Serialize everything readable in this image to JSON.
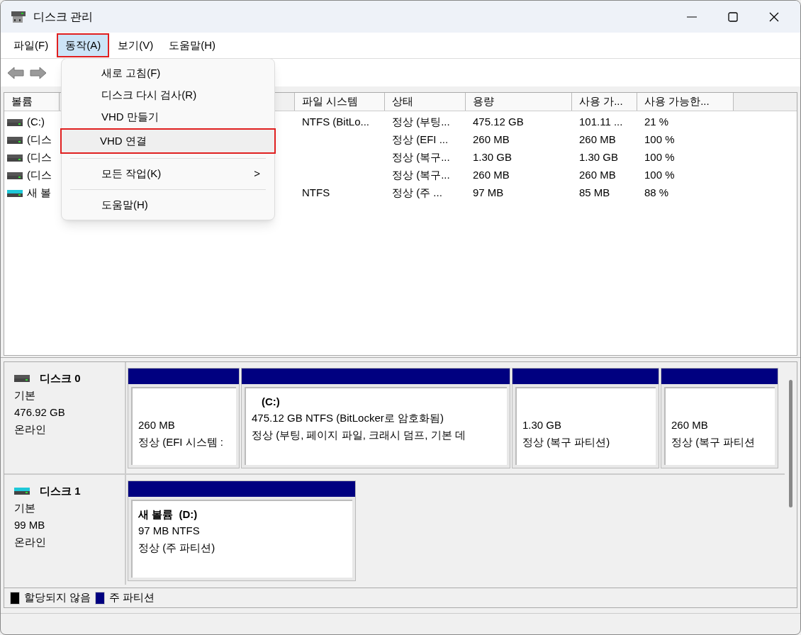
{
  "window": {
    "title": "디스크 관리"
  },
  "menu_bar": [
    {
      "label": "파일(F)",
      "selected": false
    },
    {
      "label": "동작(A)",
      "selected": true
    },
    {
      "label": "보기(V)",
      "selected": false
    },
    {
      "label": "도움말(H)",
      "selected": false
    }
  ],
  "dropdown_menu": [
    {
      "kind": "item",
      "label": "새로 고침(F)",
      "highlighted": false
    },
    {
      "kind": "item",
      "label": "디스크 다시 검사(R)",
      "highlighted": false
    },
    {
      "kind": "item",
      "label": "VHD 만들기",
      "highlighted": false
    },
    {
      "kind": "item",
      "label": "VHD 연결",
      "highlighted": true
    },
    {
      "kind": "separator"
    },
    {
      "kind": "submenu",
      "label": "모든 작업(K)",
      "arrow": ">",
      "highlighted": false
    },
    {
      "kind": "separator"
    },
    {
      "kind": "item",
      "label": "도움말(H)",
      "highlighted": false
    }
  ],
  "volume_table": {
    "columns": [
      "볼륨",
      "파일 시스템",
      "상태",
      "용량",
      "사용 가...",
      "사용 가능한..."
    ],
    "rows": [
      {
        "kind": "fixed",
        "cells": [
          "(C:)",
          "NTFS (BitLo...",
          "정상 (부팅...",
          "475.12 GB",
          "101.11 ...",
          "21 %"
        ]
      },
      {
        "kind": "fixed",
        "cells": [
          "(디스",
          "",
          "정상 (EFI ...",
          "260 MB",
          "260 MB",
          "100 %"
        ]
      },
      {
        "kind": "fixed",
        "cells": [
          "(디스",
          "",
          "정상 (복구...",
          "1.30 GB",
          "1.30 GB",
          "100 %"
        ]
      },
      {
        "kind": "fixed",
        "cells": [
          "(디스",
          "",
          "정상 (복구...",
          "260 MB",
          "260 MB",
          "100 %"
        ]
      },
      {
        "kind": "removable",
        "cells": [
          "새 볼",
          "NTFS",
          "정상 (주 ...",
          "97 MB",
          "85 MB",
          "88 %"
        ]
      }
    ]
  },
  "disks": [
    {
      "kind": "fixed",
      "name": "디스크 0",
      "type": "기본",
      "size": "476.92 GB",
      "status": "온라인",
      "partitions": [
        {
          "lines": [
            "260 MB",
            "정상 (EFI 시스템 :"
          ]
        },
        {
          "title": "(C:)",
          "lines": [
            "475.12 GB NTFS (BitLocker로 암호화됨)",
            "정상 (부팅, 페이지 파일, 크래시 덤프, 기본 데"
          ]
        },
        {
          "lines": [
            "1.30 GB",
            "정상 (복구 파티션)"
          ]
        },
        {
          "lines": [
            "260 MB",
            "정상 (복구 파티션"
          ]
        }
      ]
    },
    {
      "kind": "removable",
      "name": "디스크 1",
      "type": "기본",
      "size": "99 MB",
      "status": "온라인",
      "partitions": [
        {
          "title": "새 볼륨  (D:)",
          "lines": [
            "97 MB NTFS",
            "정상 (주 파티션)"
          ]
        }
      ]
    }
  ],
  "legend": [
    {
      "label": "할당되지 않음",
      "color": "#000000"
    },
    {
      "label": "주 파티션",
      "color": "#000080"
    }
  ]
}
